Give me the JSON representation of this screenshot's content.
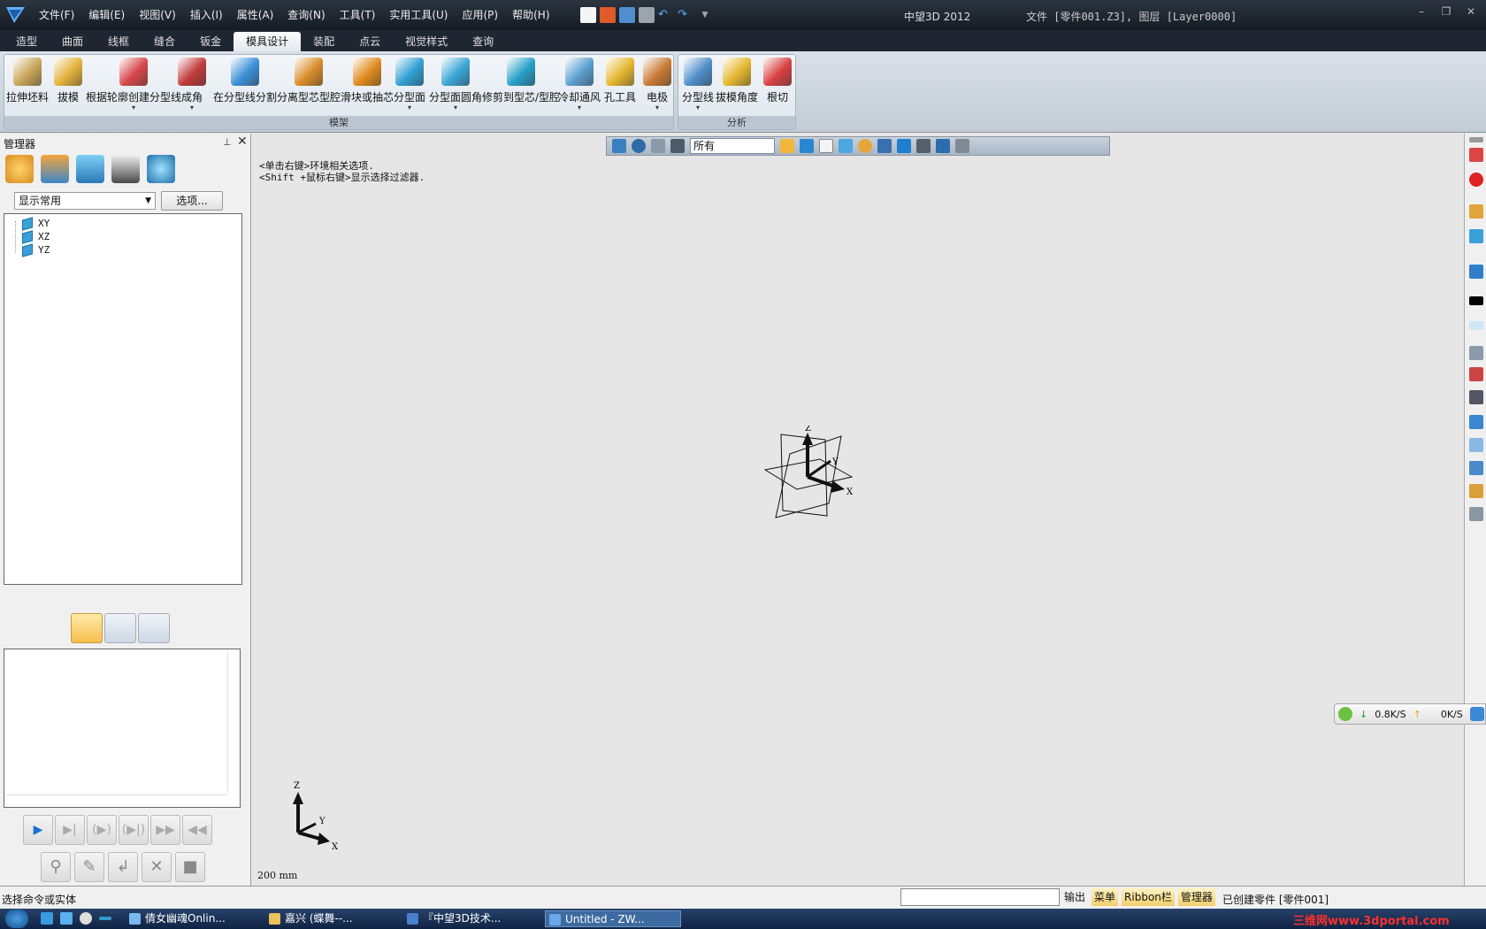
{
  "titlebar": {
    "menu": [
      "文件(F)",
      "编辑(E)",
      "视图(V)",
      "插入(I)",
      "属性(A)",
      "查询(N)",
      "工具(T)",
      "实用工具(U)",
      "应用(P)",
      "帮助(H)"
    ],
    "app_title": "中望3D 2012",
    "file_info": "文件 [零件001.Z3], 图层 [Layer0000]"
  },
  "ribbon_tabs": [
    {
      "label": "造型",
      "active": false
    },
    {
      "label": "曲面",
      "active": false
    },
    {
      "label": "线框",
      "active": false
    },
    {
      "label": "缝合",
      "active": false
    },
    {
      "label": "钣金",
      "active": false
    },
    {
      "label": "模具设计",
      "active": true
    },
    {
      "label": "装配",
      "active": false
    },
    {
      "label": "点云",
      "active": false
    },
    {
      "label": "视觉样式",
      "active": false
    },
    {
      "label": "查询",
      "active": false
    }
  ],
  "ribbon": {
    "group_mold": {
      "label": "模架",
      "buttons": [
        {
          "label": "拉伸坯料",
          "icon": "extrude-blank-icon",
          "color": "#c9a55a",
          "dropdown": false
        },
        {
          "label": "拔模",
          "icon": "draft-icon",
          "color": "#e3b23c",
          "dropdown": false
        },
        {
          "label": "根据轮廓创建分型线",
          "icon": "parting-line-from-profile-icon",
          "color": "#d8474b",
          "dropdown": true
        },
        {
          "label": "成角",
          "icon": "angle-icon",
          "color": "#c23b3b",
          "dropdown": true
        },
        {
          "label": "在分型线分割",
          "icon": "split-at-parting-line-icon",
          "color": "#3b8fd6",
          "dropdown": false
        },
        {
          "label": "分离型芯型腔",
          "icon": "split-core-cavity-icon",
          "color": "#d88c2a",
          "dropdown": false
        },
        {
          "label": "滑块或抽芯",
          "icon": "slider-icon",
          "color": "#e08a1e",
          "dropdown": false
        },
        {
          "label": "分型面",
          "icon": "parting-surface-icon",
          "color": "#2f9fd4",
          "dropdown": true
        },
        {
          "label": "分型面圆角",
          "icon": "parting-surface-fillet-icon",
          "color": "#3aa6d6",
          "dropdown": true
        },
        {
          "label": "修剪到型芯/型腔",
          "icon": "trim-to-core-cavity-icon",
          "color": "#27a0c9",
          "dropdown": false
        },
        {
          "label": "冷却通风",
          "icon": "cooling-icon",
          "color": "#5aa0d0",
          "dropdown": true
        },
        {
          "label": "孔工具",
          "icon": "hole-tool-icon",
          "color": "#e4b72f",
          "dropdown": false
        },
        {
          "label": "电极",
          "icon": "electrode-icon",
          "color": "#c97a34",
          "dropdown": true
        }
      ]
    },
    "group_analysis": {
      "label": "分析",
      "buttons": [
        {
          "label": "分型线",
          "icon": "parting-line-analysis-icon",
          "color": "#4f8fc8",
          "dropdown": true
        },
        {
          "label": "拔模角度",
          "icon": "draft-angle-icon",
          "color": "#e4b72f",
          "dropdown": false
        },
        {
          "label": "根切",
          "icon": "undercut-icon",
          "color": "#d94141",
          "dropdown": false
        }
      ]
    }
  },
  "manager": {
    "title": "管理器",
    "display_select": "显示常用",
    "options_label": "选项...",
    "tree_items": [
      "XY",
      "XZ",
      "YZ"
    ],
    "playback_buttons": [
      "play-icon",
      "step-end-icon",
      "step-forward-icon",
      "step-to-icon",
      "fast-forward-icon",
      "rewind-icon"
    ]
  },
  "viewport": {
    "filter_value": "所有",
    "hint_line1": "<单击右键>环境相关选项.",
    "hint_line2": "<Shift +鼠标右键>显示选择过滤器.",
    "scale_label": "200 mm",
    "axis_labels": {
      "x": "X",
      "y": "Y",
      "z": "Z"
    }
  },
  "netspeed": {
    "down": "0.8K/S",
    "up": "0K/S"
  },
  "statusbar": {
    "left_text": "选择命令或实体",
    "tabs": [
      {
        "label": "输出",
        "highlight": false
      },
      {
        "label": "菜单",
        "highlight": true
      },
      {
        "label": "Ribbon栏",
        "highlight": true
      },
      {
        "label": "管理器",
        "highlight": true
      }
    ],
    "message": "已创建零件 [零件001]"
  },
  "taskbar": {
    "items": [
      {
        "label": "倩女幽魂Onlin...",
        "active": false
      },
      {
        "label": "嘉兴 (蝶舞--...",
        "active": false
      },
      {
        "label": "『中望3D技术...",
        "active": false
      },
      {
        "label": "Untitled - ZW...",
        "active": true
      }
    ],
    "watermark": "三维网www.3dportal.com"
  }
}
